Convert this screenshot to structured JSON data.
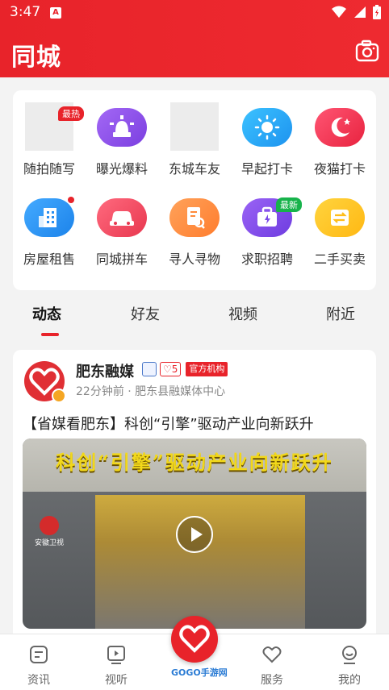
{
  "status_bar": {
    "time": "3:47"
  },
  "header": {
    "title": "同城"
  },
  "shortcuts": [
    {
      "label": "随拍随写",
      "badge": "最热",
      "icon": "image-placeholder"
    },
    {
      "label": "曝光爆料",
      "icon": "alarm-light-icon",
      "color": "#8b4fe3"
    },
    {
      "label": "东城车友",
      "icon": "image-placeholder"
    },
    {
      "label": "早起打卡",
      "icon": "sun-icon",
      "color": "#27a7f2"
    },
    {
      "label": "夜猫打卡",
      "icon": "moon-icon",
      "color": "#f4375a"
    },
    {
      "label": "房屋租售",
      "icon": "building-icon",
      "color": "#2e96f0"
    },
    {
      "label": "同城拼车",
      "icon": "car-icon",
      "color": "#ef4a61"
    },
    {
      "label": "寻人寻物",
      "icon": "search-doc-icon",
      "color": "#ff8a3a"
    },
    {
      "label": "求职招聘",
      "badge": "最新",
      "icon": "briefcase-icon",
      "color": "#7c4be8"
    },
    {
      "label": "二手买卖",
      "icon": "swap-icon",
      "color": "#ffc21d"
    }
  ],
  "tabs": [
    "动态",
    "好友",
    "视频",
    "附近"
  ],
  "post": {
    "author": "肥东融媒",
    "heart_count": "5",
    "official_badge": "官方机构",
    "meta": "22分钟前 · 肥东县融媒体中心",
    "headline": "【省媒看肥东】科创“引擎”驱动产业向新跃升",
    "video_title": "科创“引擎”驱动产业向新跃升",
    "video_logo_text": "安徽卫视"
  },
  "bottom_nav": [
    "资讯",
    "视听",
    "服务",
    "我的"
  ],
  "watermark": "GOGO手游网",
  "colors": {
    "brand_red": "#e8232a"
  }
}
